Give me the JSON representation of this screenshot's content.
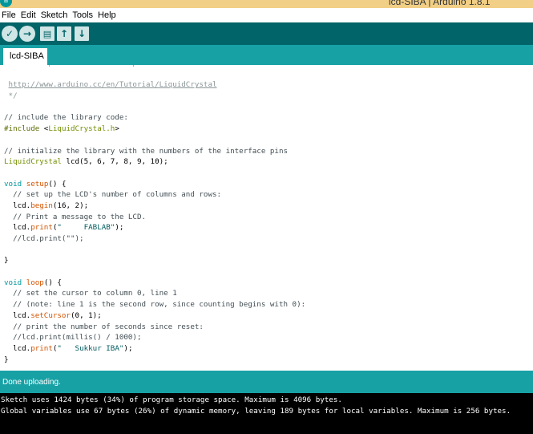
{
  "window": {
    "title": "lcd-SIBA | Arduino 1.8.1",
    "icon_label": "∞"
  },
  "menu": [
    "File",
    "Edit",
    "Sketch",
    "Tools",
    "Help"
  ],
  "toolbar": {
    "verify_icon": "✓",
    "upload_icon": "→",
    "new_icon": "▤",
    "open_icon": "↑",
    "save_icon": "↓"
  },
  "tabs": [
    {
      "label": "lcd-SIBA"
    }
  ],
  "code_lines": [
    [
      {
        "t": " This example code is in the public domain.",
        "c": "cm-faint"
      }
    ],
    [],
    [
      {
        "t": " ",
        "c": ""
      },
      {
        "t": "http://www.arduino.cc/en/Tutorial/LiquidCrystal",
        "c": "lnk"
      }
    ],
    [
      {
        "t": " */",
        "c": "cm-faint"
      }
    ],
    [],
    [
      {
        "t": "// include the library code:",
        "c": "cm"
      }
    ],
    [
      {
        "t": "#include",
        "c": "pp"
      },
      {
        "t": " <",
        "c": ""
      },
      {
        "t": "LiquidCrystal.h",
        "c": "ty"
      },
      {
        "t": ">",
        "c": ""
      }
    ],
    [],
    [
      {
        "t": "// initialize the library with the numbers of the interface pins",
        "c": "cm"
      }
    ],
    [
      {
        "t": "LiquidCrystal",
        "c": "ty"
      },
      {
        "t": " lcd(5, 6, 7, 8, 9, 10);",
        "c": ""
      }
    ],
    [],
    [
      {
        "t": "void",
        "c": "kw"
      },
      {
        "t": " ",
        "c": ""
      },
      {
        "t": "setup",
        "c": "fn"
      },
      {
        "t": "() {",
        "c": ""
      }
    ],
    [
      {
        "t": "  // set up the LCD's number of columns and rows:",
        "c": "cm"
      }
    ],
    [
      {
        "t": "  lcd.",
        "c": ""
      },
      {
        "t": "begin",
        "c": "fn"
      },
      {
        "t": "(16, 2);",
        "c": ""
      }
    ],
    [
      {
        "t": "  // Print a message to the LCD.",
        "c": "cm"
      }
    ],
    [
      {
        "t": "  lcd.",
        "c": ""
      },
      {
        "t": "print",
        "c": "fn"
      },
      {
        "t": "(",
        "c": ""
      },
      {
        "t": "\"     FABLAB\"",
        "c": "str"
      },
      {
        "t": ");",
        "c": ""
      }
    ],
    [
      {
        "t": "  //lcd.print(\"\");",
        "c": "cm"
      }
    ],
    [],
    [
      {
        "t": "}",
        "c": ""
      }
    ],
    [],
    [
      {
        "t": "void",
        "c": "kw"
      },
      {
        "t": " ",
        "c": ""
      },
      {
        "t": "loop",
        "c": "fn"
      },
      {
        "t": "() {",
        "c": ""
      }
    ],
    [
      {
        "t": "  // set the cursor to column 0, line 1",
        "c": "cm"
      }
    ],
    [
      {
        "t": "  // (note: line 1 is the second row, since counting begins with 0):",
        "c": "cm"
      }
    ],
    [
      {
        "t": "  lcd.",
        "c": ""
      },
      {
        "t": "setCursor",
        "c": "fn"
      },
      {
        "t": "(0, 1);",
        "c": ""
      }
    ],
    [
      {
        "t": "  // print the number of seconds since reset:",
        "c": "cm"
      }
    ],
    [
      {
        "t": "  //lcd.print(millis() / 1000);",
        "c": "cm"
      }
    ],
    [
      {
        "t": "  lcd.",
        "c": ""
      },
      {
        "t": "print",
        "c": "fn"
      },
      {
        "t": "(",
        "c": ""
      },
      {
        "t": "\"   Sukkur IBA\"",
        "c": "str"
      },
      {
        "t": ");",
        "c": ""
      }
    ],
    [
      {
        "t": "}",
        "c": ""
      }
    ]
  ],
  "status": {
    "message": "Done uploading."
  },
  "console": {
    "lines": [
      "Sketch uses 1424 bytes (34%) of program storage space. Maximum is 4096 bytes.",
      "Global variables use 67 bytes (26%) of dynamic memory, leaving 189 bytes for local variables. Maximum is 256 bytes."
    ]
  },
  "colors": {
    "toolbar_bg": "#006468",
    "tabbar_bg": "#17a1a5",
    "console_bg": "#000000",
    "titlebar_bg": "#f2cf86"
  }
}
